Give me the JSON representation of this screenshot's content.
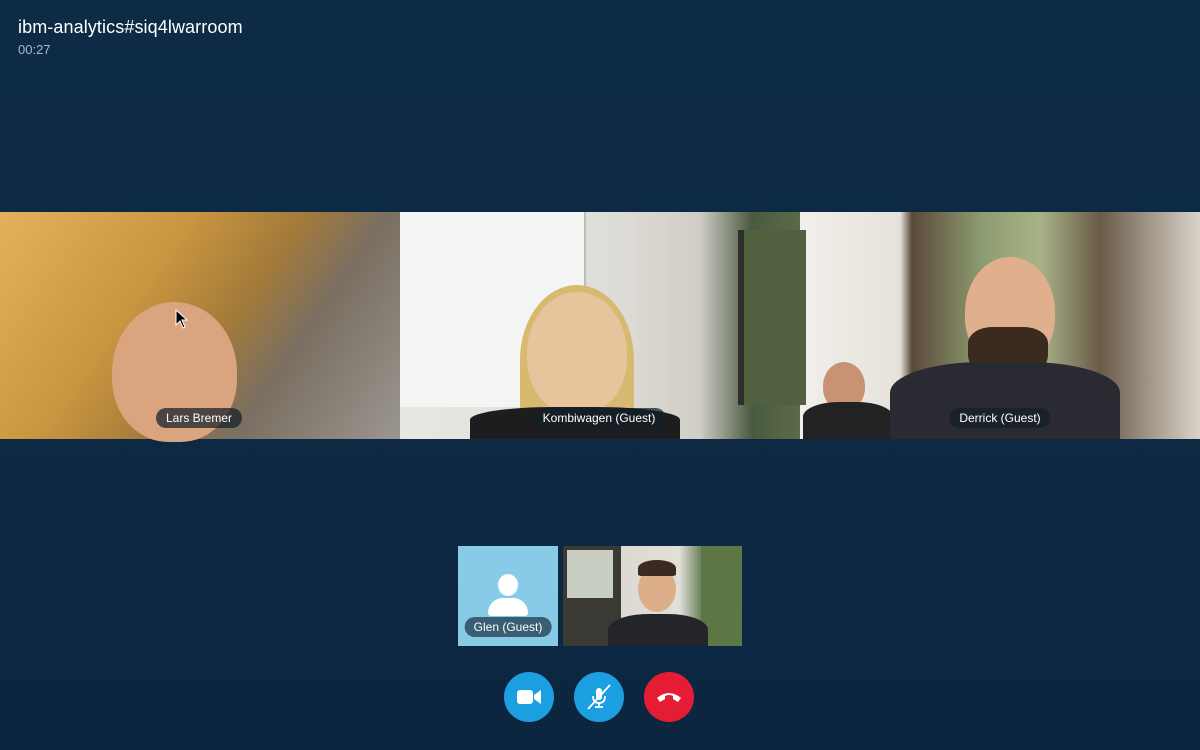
{
  "call": {
    "title": "ibm-analytics#siq4lwarroom",
    "timer": "00:27"
  },
  "participants": [
    {
      "name": "Lars Bremer"
    },
    {
      "name": "Kombiwagen (Guest)"
    },
    {
      "name": "Derrick (Guest)"
    }
  ],
  "self_strip": {
    "guest_name": "Glen (Guest)"
  },
  "controls": {
    "video_icon": "video-camera-icon",
    "mute_icon": "microphone-muted-icon",
    "end_icon": "end-call-icon",
    "colors": {
      "primary": "#1c9fe0",
      "danger": "#e41d35"
    }
  }
}
